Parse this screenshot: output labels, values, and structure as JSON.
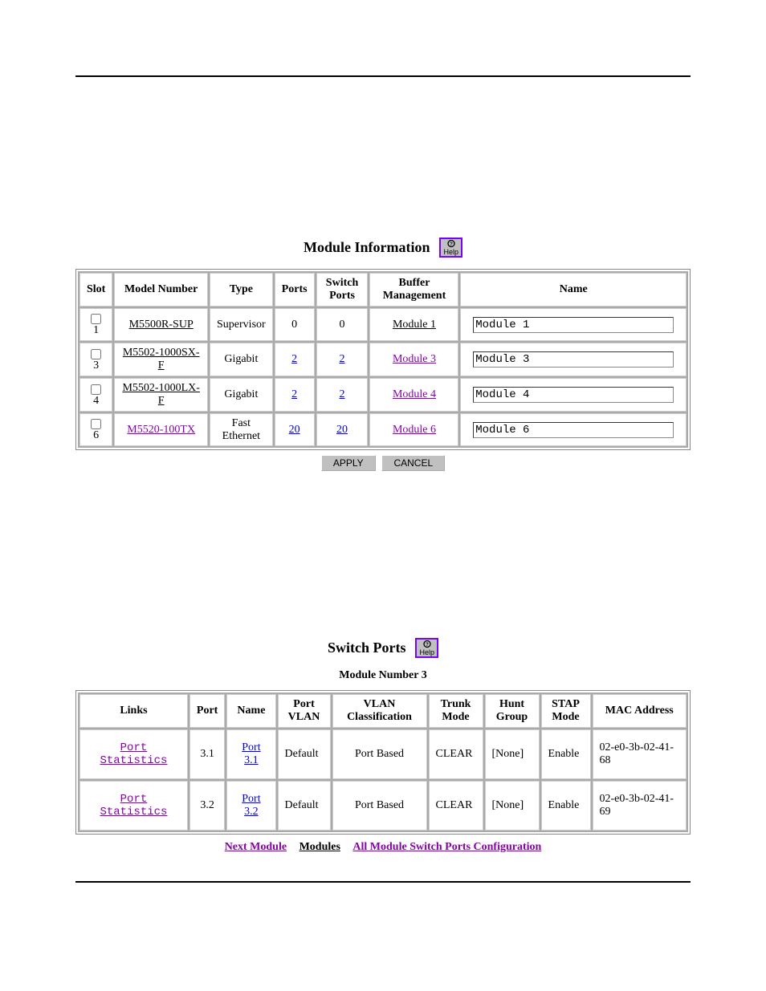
{
  "module_info": {
    "title": "Module Information",
    "help_label": "Help",
    "headers": {
      "slot": "Slot",
      "model": "Model Number",
      "type": "Type",
      "ports": "Ports",
      "switch_ports": "Switch Ports",
      "buffer": "Buffer Management",
      "name": "Name"
    },
    "rows": [
      {
        "slot": "1",
        "model": "M5500R-SUP",
        "model_style": "u",
        "type": "Supervisor",
        "ports": "0",
        "ports_link": false,
        "sports": "0",
        "sports_link": false,
        "buffer": "Module 1",
        "buffer_style": "u",
        "name": "Module 1"
      },
      {
        "slot": "3",
        "model": "M5502-1000SX-F",
        "model_style": "u",
        "type": "Gigabit",
        "ports": "2",
        "ports_link": true,
        "sports": "2",
        "sports_link": true,
        "buffer": "Module 3",
        "buffer_style": "v",
        "name": "Module 3"
      },
      {
        "slot": "4",
        "model": "M5502-1000LX-F",
        "model_style": "u",
        "type": "Gigabit",
        "ports": "2",
        "ports_link": true,
        "sports": "2",
        "sports_link": true,
        "buffer": "Module 4",
        "buffer_style": "v",
        "name": "Module 4"
      },
      {
        "slot": "6",
        "model": "M5520-100TX",
        "model_style": "v",
        "type": "Fast Ethernet",
        "ports": "20",
        "ports_link": true,
        "sports": "20",
        "sports_link": true,
        "buffer": "Module 6",
        "buffer_style": "v",
        "name": "Module 6"
      }
    ],
    "buttons": {
      "apply": "APPLY",
      "cancel": "CANCEL"
    }
  },
  "switch_ports": {
    "title": "Switch Ports",
    "help_label": "Help",
    "subtitle": "Module Number 3",
    "headers": {
      "links": "Links",
      "port": "Port",
      "name": "Name",
      "pvlan": "Port VLAN",
      "vclass": "VLAN Classification",
      "trunk": "Trunk Mode",
      "hunt": "Hunt Group",
      "stap": "STAP Mode",
      "mac": "MAC Address"
    },
    "rows": [
      {
        "links": "Port Statistics",
        "port": "3.1",
        "name": "Port 3.1",
        "pvlan": "Default",
        "vclass": "Port Based",
        "trunk": "CLEAR",
        "hunt": "[None]",
        "stap": "Enable",
        "mac": "02-e0-3b-02-41-68"
      },
      {
        "links": "Port Statistics",
        "port": "3.2",
        "name": "Port 3.2",
        "pvlan": "Default",
        "vclass": "Port Based",
        "trunk": "CLEAR",
        "hunt": "[None]",
        "stap": "Enable",
        "mac": "02-e0-3b-02-41-69"
      }
    ],
    "nav": {
      "next": "Next Module",
      "modules": "Modules",
      "all": "All Module Switch Ports Configuration"
    }
  }
}
